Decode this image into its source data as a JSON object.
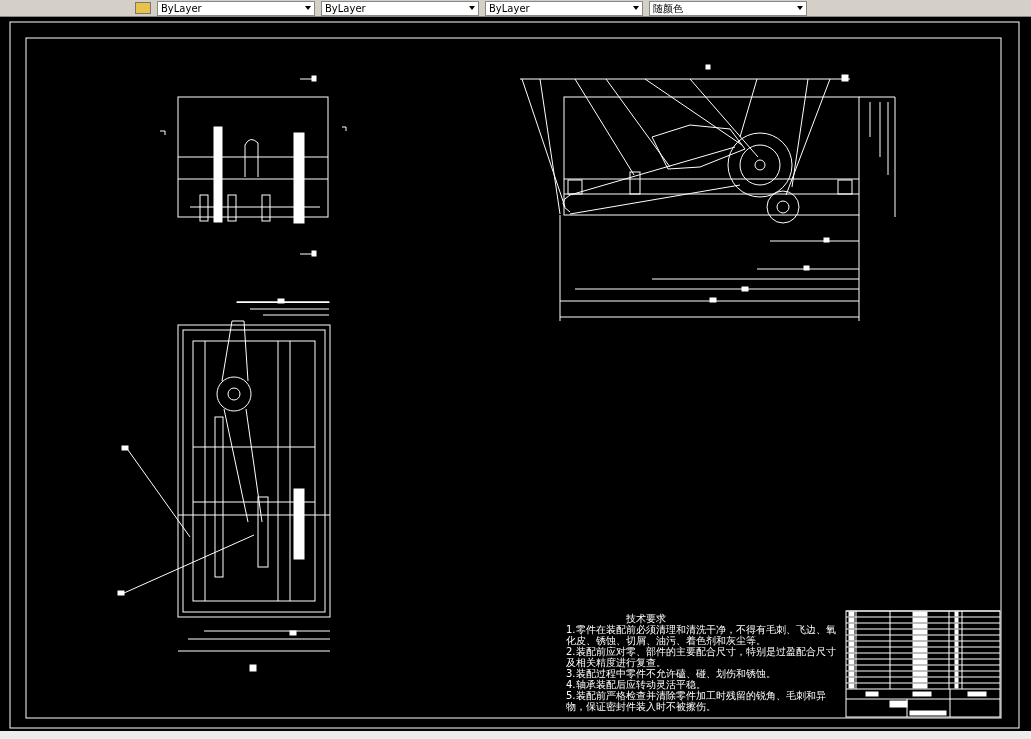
{
  "toolbar": {
    "dropdowns": [
      {
        "value": "ByLayer"
      },
      {
        "value": "ByLayer"
      },
      {
        "value": "ByLayer"
      },
      {
        "value": "随颜色"
      }
    ]
  },
  "notes": {
    "title": "技术要求",
    "lines": [
      "1.零件在装配前必须清理和清洗干净，不得有毛刺、飞边、氧化皮、锈蚀、切屑、油污、着色剂和灰尘等。",
      "2.装配前应对零、部件的主要配合尺寸，特别是过盈配合尺寸及相关精度进行复查。",
      "3.装配过程中零件不允许磕、碰、划伤和锈蚀。",
      "4.轴承装配后应转动灵活平稳。",
      "5.装配前严格检查并清除零件加工时残留的锐角、毛刺和异物，保证密封件装入时不被擦伤。"
    ]
  }
}
